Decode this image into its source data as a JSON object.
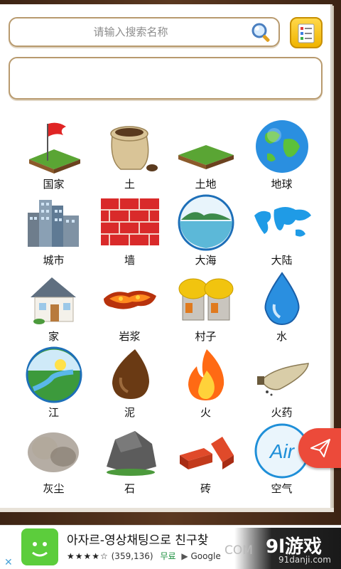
{
  "search": {
    "placeholder": "请输入搜索名称"
  },
  "elements": [
    {
      "label": "国家",
      "icon": "flag-on-grass-icon"
    },
    {
      "label": "土",
      "icon": "soil-sack-icon"
    },
    {
      "label": "土地",
      "icon": "grass-tile-icon"
    },
    {
      "label": "地球",
      "icon": "earth-globe-icon"
    },
    {
      "label": "城市",
      "icon": "city-buildings-icon"
    },
    {
      "label": "墙",
      "icon": "brick-wall-icon"
    },
    {
      "label": "大海",
      "icon": "sea-icon"
    },
    {
      "label": "大陆",
      "icon": "continent-map-icon"
    },
    {
      "label": "家",
      "icon": "house-icon"
    },
    {
      "label": "岩浆",
      "icon": "lava-icon"
    },
    {
      "label": "村子",
      "icon": "village-huts-icon"
    },
    {
      "label": "水",
      "icon": "water-drop-icon"
    },
    {
      "label": "江",
      "icon": "river-icon"
    },
    {
      "label": "泥",
      "icon": "mud-icon"
    },
    {
      "label": "火",
      "icon": "fire-icon"
    },
    {
      "label": "火药",
      "icon": "gunpowder-horn-icon"
    },
    {
      "label": "灰尘",
      "icon": "dust-cloud-icon"
    },
    {
      "label": "石",
      "icon": "stone-icon"
    },
    {
      "label": "砖",
      "icon": "bricks-icon"
    },
    {
      "label": "空气",
      "icon": "air-icon"
    }
  ],
  "ad": {
    "title": "아자르-영상채팅으로 친구찾",
    "stars": "★★★★☆",
    "reviews": "(359,136)",
    "price": "무료",
    "store": "Google",
    "close": "✕"
  },
  "watermark": {
    "com": "COM",
    "logo": "9l游戏",
    "url": "91danji.com"
  },
  "colors": {
    "frame": "#4a2e1c",
    "field_border": "#b89a6e",
    "notes_button": "#f0b400",
    "fab": "#ec4a3a"
  }
}
